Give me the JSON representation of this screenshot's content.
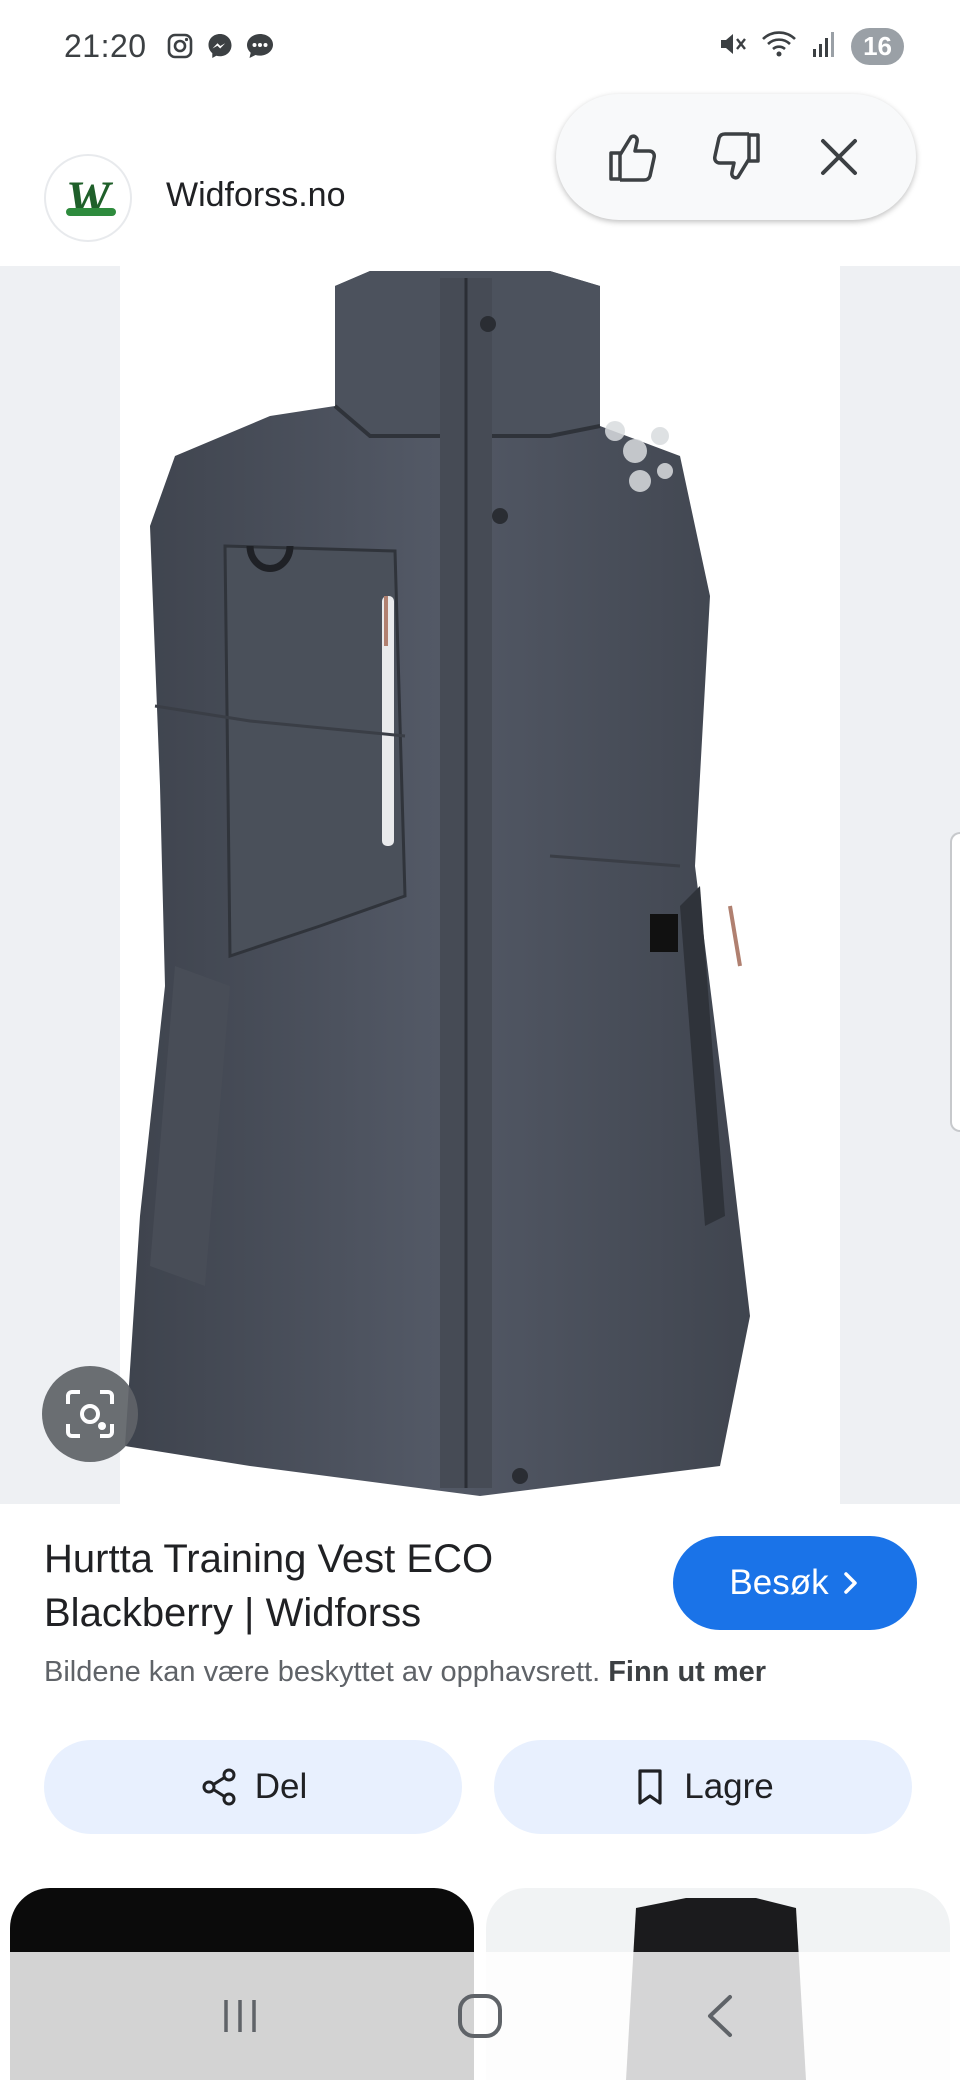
{
  "status_bar": {
    "time": "21:20",
    "battery": "16",
    "left_icons": [
      "instagram-icon",
      "messenger-icon",
      "chat-icon"
    ],
    "right_icons": [
      "mute-icon",
      "wifi-icon",
      "signal-icon"
    ]
  },
  "header": {
    "site_name": "Widforss.no",
    "logo_letter": "W"
  },
  "feedback": {
    "icons": [
      "thumbs-up-icon",
      "thumbs-down-icon",
      "close-icon"
    ]
  },
  "result": {
    "title": "Hurtta Training Vest ECO Blackberry | Widforss",
    "visit_label": "Besøk",
    "copyright_text": "Bildene kan være beskyttet av opphavsrett.",
    "learn_more": "Finn ut mer"
  },
  "actions": {
    "share_label": "Del",
    "save_label": "Lagre"
  },
  "colors": {
    "accent": "#1a73e8",
    "pill_bg": "#e8f0fe",
    "vest": "#4a4f5a"
  }
}
